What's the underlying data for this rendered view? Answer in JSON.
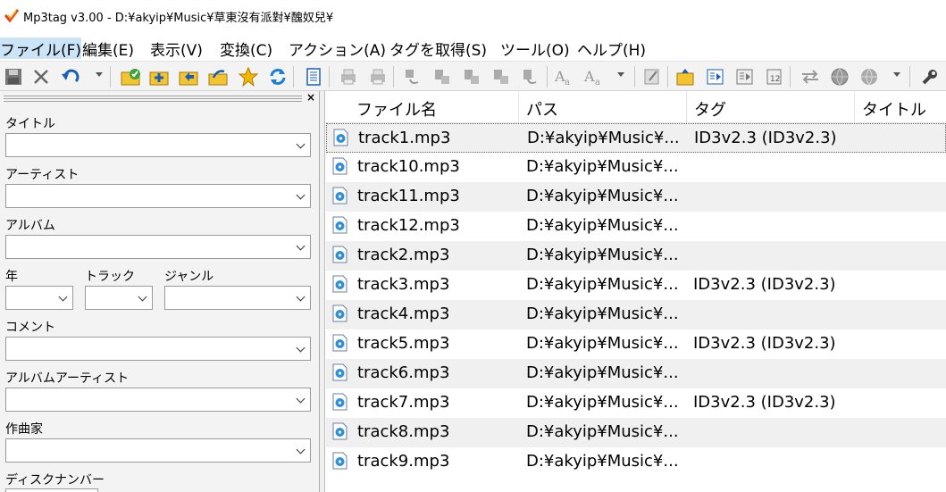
{
  "window": {
    "title": "Mp3tag v3.00  -  D:¥akyip¥Music¥草東沒有派對¥醜奴兒¥"
  },
  "menu": {
    "file": "ファイル(F)",
    "edit": "編集(E)",
    "view": "表示(V)",
    "convert": "変換(C)",
    "action": "アクション(A)",
    "get_tags": "タグを取得(S)",
    "tools": "ツール(O)",
    "help": "ヘルプ(H)"
  },
  "toolbar_icons": [
    "save-icon",
    "remove-icon",
    "undo-icon",
    "dropdown-icon",
    "tagged-folder-icon",
    "add-folder-icon",
    "open-folder-icon",
    "export-icon",
    "star-icon",
    "refresh-icon",
    "list-icon",
    "print-icon",
    "print-preview-icon",
    "tag-file-icon",
    "file-tag-icon",
    "tag-tag-icon",
    "text-file-icon",
    "filename-icon",
    "case-a-icon",
    "case-conv-icon",
    "dropdown-icon",
    "edit-icon",
    "sort-icon",
    "play-icon",
    "playlist-icon",
    "numbering-icon",
    "swap-icon",
    "web-icon",
    "web-source-icon",
    "dropdown-icon",
    "settings-icon"
  ],
  "panel": {
    "title_label": "タイトル",
    "artist_label": "アーティスト",
    "album_label": "アルバム",
    "year_label": "年",
    "track_label": "トラック",
    "genre_label": "ジャンル",
    "comment_label": "コメント",
    "album_artist_label": "アルバムアーティスト",
    "composer_label": "作曲家",
    "disc_number_label": "ディスクナンバー"
  },
  "list": {
    "columns": [
      "ファイル名",
      "パス",
      "タグ",
      "タイトル"
    ],
    "rows": [
      {
        "name": "track1.mp3",
        "path": "D:¥akyip¥Music¥...",
        "tag": "ID3v2.3 (ID3v2.3)"
      },
      {
        "name": "track10.mp3",
        "path": "D:¥akyip¥Music¥...",
        "tag": ""
      },
      {
        "name": "track11.mp3",
        "path": "D:¥akyip¥Music¥...",
        "tag": ""
      },
      {
        "name": "track12.mp3",
        "path": "D:¥akyip¥Music¥...",
        "tag": ""
      },
      {
        "name": "track2.mp3",
        "path": "D:¥akyip¥Music¥...",
        "tag": ""
      },
      {
        "name": "track3.mp3",
        "path": "D:¥akyip¥Music¥...",
        "tag": "ID3v2.3 (ID3v2.3)"
      },
      {
        "name": "track4.mp3",
        "path": "D:¥akyip¥Music¥...",
        "tag": ""
      },
      {
        "name": "track5.mp3",
        "path": "D:¥akyip¥Music¥...",
        "tag": "ID3v2.3 (ID3v2.3)"
      },
      {
        "name": "track6.mp3",
        "path": "D:¥akyip¥Music¥...",
        "tag": ""
      },
      {
        "name": "track7.mp3",
        "path": "D:¥akyip¥Music¥...",
        "tag": "ID3v2.3 (ID3v2.3)"
      },
      {
        "name": "track8.mp3",
        "path": "D:¥akyip¥Music¥...",
        "tag": ""
      },
      {
        "name": "track9.mp3",
        "path": "D:¥akyip¥Music¥...",
        "tag": ""
      }
    ]
  },
  "colors": {
    "menu_active": "#cce4f7",
    "toolbar_bg": "#f3f3f3",
    "row_alt": "#f0f0f0"
  }
}
